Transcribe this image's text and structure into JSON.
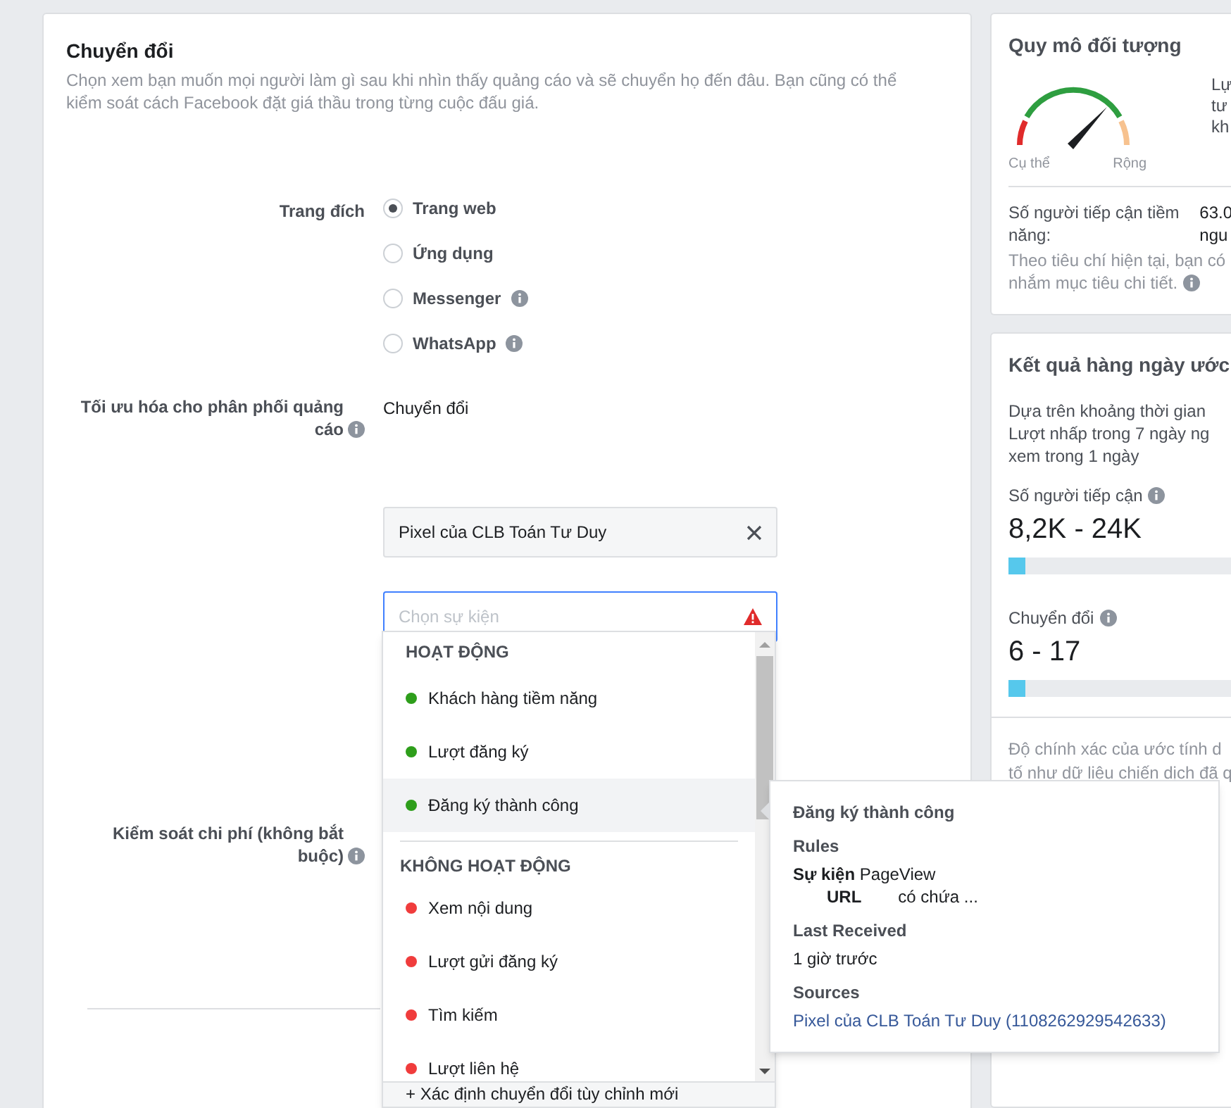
{
  "conversion": {
    "title": "Chuyển đổi",
    "description": "Chọn xem bạn muốn mọi người làm gì sau khi nhìn thấy quảng cáo và sẽ chuyển họ đến đâu. Bạn cũng có thể kiểm soát cách Facebook đặt giá thầu trong từng cuộc đấu giá.",
    "destination": {
      "label": "Trang đích",
      "options": [
        {
          "label": "Trang web",
          "selected": true,
          "info": false
        },
        {
          "label": "Ứng dụng",
          "selected": false,
          "info": false
        },
        {
          "label": "Messenger",
          "selected": false,
          "info": true
        },
        {
          "label": "WhatsApp",
          "selected": false,
          "info": true
        }
      ]
    },
    "optimization": {
      "label": "Tối ưu hóa cho phân phối quảng cáo",
      "value": "Chuyển đổi"
    },
    "pixel": {
      "value": "Pixel của CLB Toán Tư Duy"
    },
    "event_field": {
      "placeholder": "Chọn sự kiện",
      "error": true
    },
    "cost_control": {
      "label": "Kiểm soát chi phí (không bắt buộc)"
    },
    "dropdown": {
      "groups": [
        {
          "heading": "HOẠT ĐỘNG",
          "items": [
            {
              "label": "Khách hàng tiềm năng",
              "color": "#2e9e1b",
              "selected": false
            },
            {
              "label": "Lượt đăng ký",
              "color": "#2e9e1b",
              "selected": false
            },
            {
              "label": "Đăng ký thành công",
              "color": "#2e9e1b",
              "selected": true
            }
          ]
        },
        {
          "heading": "KHÔNG HOẠT ĐỘNG",
          "items": [
            {
              "label": "Xem nội dung",
              "color": "#f03c3c",
              "selected": false
            },
            {
              "label": "Lượt gửi đăng ký",
              "color": "#f03c3c",
              "selected": false
            },
            {
              "label": "Tìm kiếm",
              "color": "#f03c3c",
              "selected": false
            },
            {
              "label": "Lượt liên hệ",
              "color": "#f03c3c",
              "selected": false
            }
          ]
        }
      ],
      "footer": "+ Xác định chuyển đổi tùy chỉnh mới"
    },
    "tooltip": {
      "title": "Đăng ký thành công",
      "rules_heading": "Rules",
      "rule_event_label": "Sự kiện",
      "rule_event_value": "PageView",
      "rule_field": "URL",
      "rule_operator": "có chứa ...",
      "last_received_heading": "Last Received",
      "last_received": "1 giờ trước",
      "sources_heading": "Sources",
      "source_link": "Pixel của CLB Toán Tư Duy (1108262929542633)"
    }
  },
  "audience": {
    "title": "Quy mô đối tượng",
    "gauge_min": "Cụ thể",
    "gauge_max": "Rộng",
    "side_lines": [
      "Lự",
      "tư",
      "kh"
    ],
    "reach_label": "Số người tiếp cận tiềm năng:",
    "reach_value_lines": [
      "63.0",
      "ngu"
    ],
    "note_lines": [
      "Theo tiêu chí hiện tại, bạn có",
      "nhắm mục tiêu chi tiết."
    ]
  },
  "daily": {
    "title": "Kết quả hàng ngày ước",
    "intro_lines": [
      "Dựa trên khoảng thời gian",
      "Lượt nhấp trong 7 ngày ng",
      "xem trong 1 ngày"
    ],
    "metrics": [
      {
        "label": "Số người tiếp cận",
        "value": "8,2K - 24K",
        "level": 0.06
      },
      {
        "label": "Chuyển đổi",
        "value": "6 - 17",
        "level": 0.06
      }
    ],
    "accuracy_lines": [
      "Độ chính xác của ước tính d",
      "tố như dữ liệu chiến dịch đã q"
    ]
  }
}
